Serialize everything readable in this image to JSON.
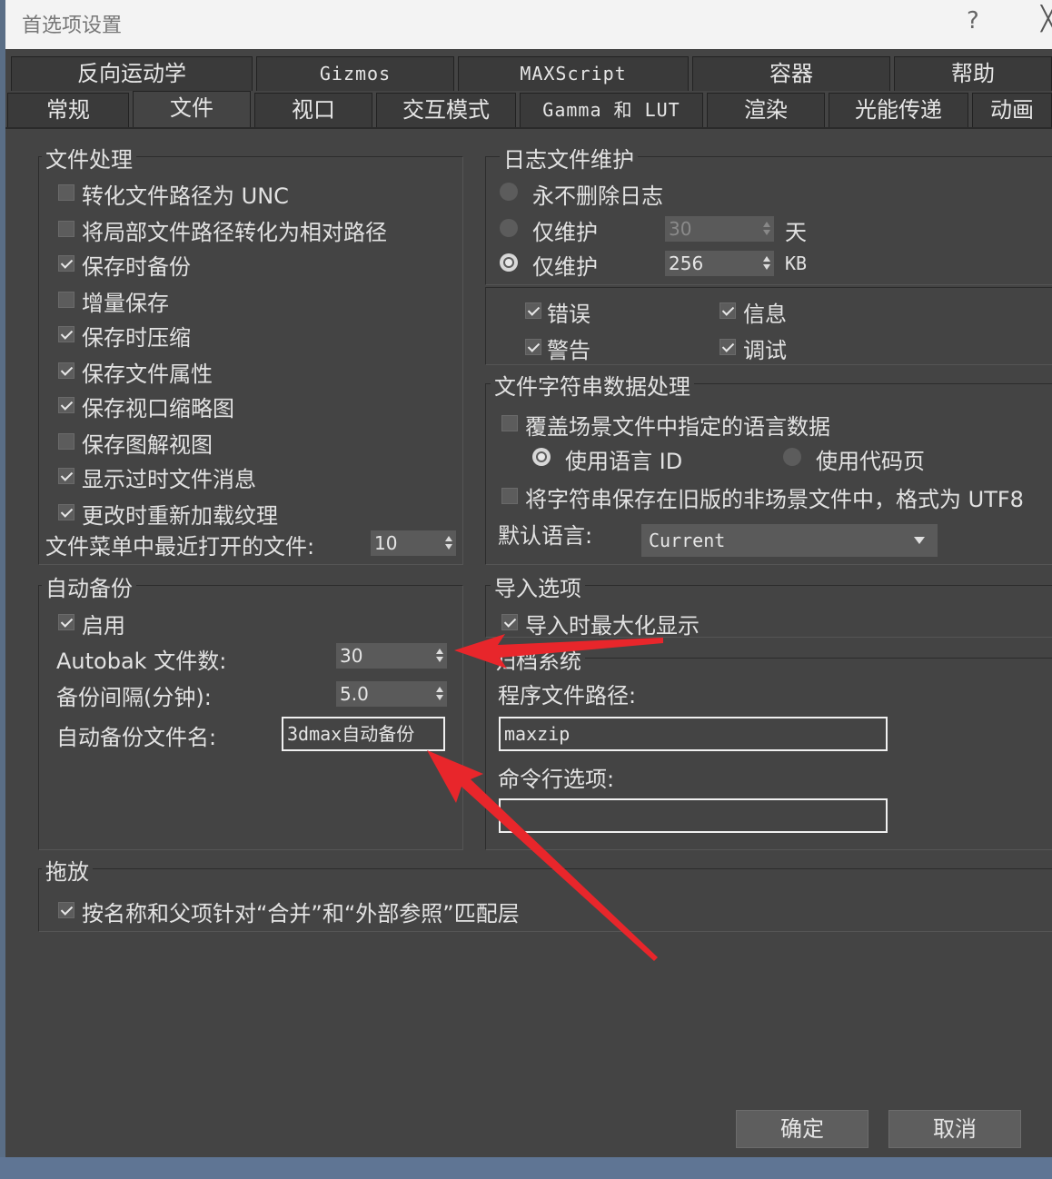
{
  "window": {
    "title": "首选项设置",
    "help_glyph": "?",
    "close_glyph": "╳"
  },
  "tabs": {
    "row1": [
      "反向运动学",
      "Gizmos",
      "MAXScript",
      "容器",
      "帮助"
    ],
    "row2": [
      "常规",
      "文件",
      "视口",
      "交互模式",
      "Gamma 和 LUT",
      "渲染",
      "光能传递",
      "动画"
    ],
    "active": "文件"
  },
  "file_handling": {
    "title": "文件处理",
    "options": [
      {
        "label": "转化文件路径为 UNC",
        "checked": false
      },
      {
        "label": "将局部文件路径转化为相对路径",
        "checked": false
      },
      {
        "label": "保存时备份",
        "checked": true
      },
      {
        "label": "增量保存",
        "checked": false
      },
      {
        "label": "保存时压缩",
        "checked": true
      },
      {
        "label": "保存文件属性",
        "checked": true
      },
      {
        "label": "保存视口缩略图",
        "checked": true
      },
      {
        "label": "保存图解视图",
        "checked": false
      },
      {
        "label": "显示过时文件消息",
        "checked": true
      },
      {
        "label": "更改时重新加载纹理",
        "checked": true
      }
    ],
    "recent_label": "文件菜单中最近打开的文件:",
    "recent_value": "10"
  },
  "autobackup": {
    "title": "自动备份",
    "enable_label": "启用",
    "enable_checked": true,
    "count_label": "Autobak 文件数:",
    "count_value": "30",
    "interval_label": "备份间隔(分钟):",
    "interval_value": "5.0",
    "name_label": "自动备份文件名:",
    "name_value": "3dmax自动备份"
  },
  "drag_drop": {
    "title": "拖放",
    "option_label": "按名称和父项针对“合并”和“外部参照”匹配层",
    "option_checked": true
  },
  "log_maintenance": {
    "title": "日志文件维护",
    "never_delete": "永不删除日志",
    "keep_days_label": "仅维护",
    "keep_days_value": "30",
    "days_unit": "天",
    "keep_kb_label": "仅维护",
    "keep_kb_value": "256",
    "kb_unit": "KB",
    "selected": "kb",
    "levels": [
      {
        "label": "错误",
        "checked": true
      },
      {
        "label": "信息",
        "checked": true
      },
      {
        "label": "警告",
        "checked": true
      },
      {
        "label": "调试",
        "checked": true
      }
    ]
  },
  "string_data": {
    "title": "文件字符串数据处理",
    "override_label": "覆盖场景文件中指定的语言数据",
    "override_checked": false,
    "use_lang_id": "使用语言 ID",
    "use_codepage": "使用代码页",
    "legacy_label": "将字符串保存在旧版的非场景文件中，格式为 UTF8",
    "legacy_checked": false,
    "default_lang_label": "默认语言:",
    "default_lang_value": "Current"
  },
  "import": {
    "title": "导入选项",
    "maximize_label": "导入时最大化显示",
    "maximize_checked": true
  },
  "archive": {
    "title": "归档系统",
    "program_label": "程序文件路径:",
    "program_value": "maxzip",
    "cmdline_label": "命令行选项:",
    "cmdline_value": ""
  },
  "buttons": {
    "ok": "确定",
    "cancel": "取消"
  },
  "colors": {
    "annotation": "#e8262b",
    "panel": "#444444"
  }
}
